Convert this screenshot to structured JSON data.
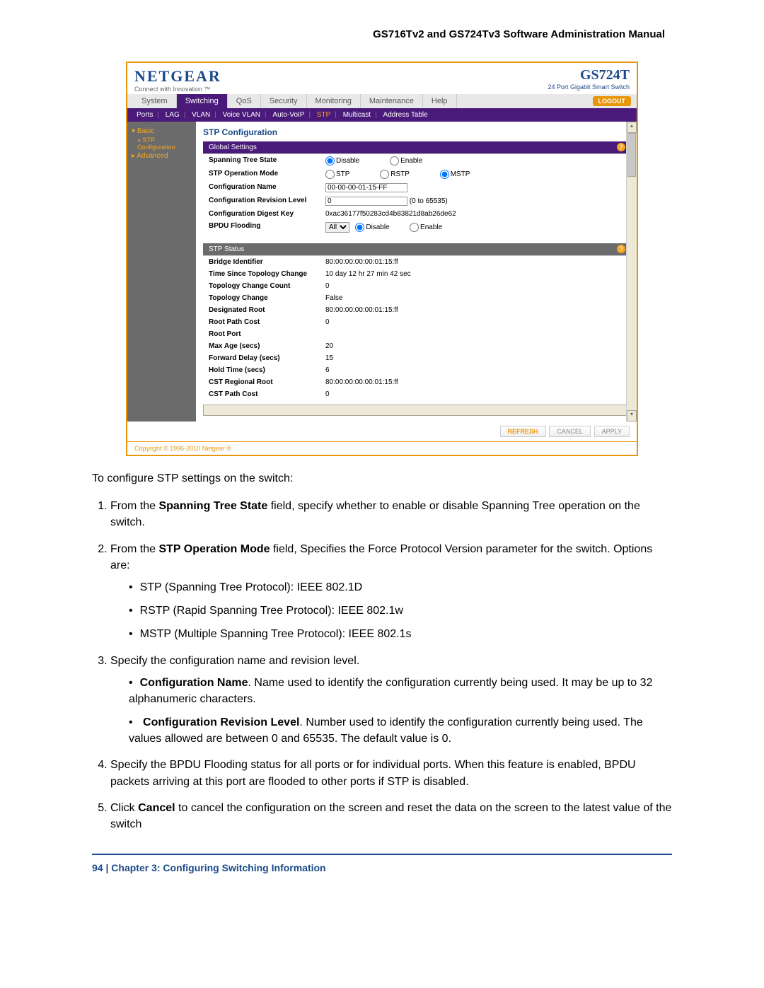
{
  "doc": {
    "header": "GS716Tv2 and GS724Tv3 Software Administration Manual",
    "pagenum": "94",
    "chapter": "Chapter 3:  Configuring Switching Information",
    "footer_sep": "   |   "
  },
  "ui": {
    "logo": "NETGEAR",
    "logosub": "Connect with Innovation ™",
    "model": "GS724T",
    "modelsub": "24 Port Gigabit Smart Switch",
    "logout": "LOGOUT",
    "tabs": [
      "System",
      "Switching",
      "QoS",
      "Security",
      "Monitoring",
      "Maintenance",
      "Help"
    ],
    "active_tab": "Switching",
    "subtabs": [
      "Ports",
      "LAG",
      "VLAN",
      "Voice VLAN",
      "Auto-VoIP",
      "STP",
      "Multicast",
      "Address Table"
    ],
    "active_subtab": "STP",
    "sidebar": {
      "basic": "Basic",
      "stp": "STP",
      "config": "Configuration",
      "advanced": "Advanced"
    },
    "sections": {
      "title": "STP Configuration",
      "global": "Global Settings",
      "status": "STP Status"
    },
    "global_rows": {
      "spanning_tree_state": {
        "label": "Spanning Tree State",
        "opts": [
          "Disable",
          "Enable"
        ],
        "sel": "Disable"
      },
      "stp_mode": {
        "label": "STP Operation Mode",
        "opts": [
          "STP",
          "RSTP",
          "MSTP"
        ],
        "sel": "MSTP"
      },
      "config_name": {
        "label": "Configuration Name",
        "val": "00-00-00-01-15-FF"
      },
      "revision": {
        "label": "Configuration Revision Level",
        "val": "0",
        "hint": "(0 to 65535)"
      },
      "digest": {
        "label": "Configuration Digest Key",
        "val": "0xac36177f50283cd4b83821d8ab26de62"
      },
      "bpdu": {
        "label": "BPDU Flooding",
        "select": "All",
        "opts": [
          "Disable",
          "Enable"
        ],
        "sel": "Disable"
      }
    },
    "status_rows": [
      {
        "label": "Bridge Identifier",
        "val": "80:00:00:00:00:01:15:ff"
      },
      {
        "label": "Time Since Topology Change",
        "val": "10 day 12 hr 27 min 42 sec"
      },
      {
        "label": "Topology Change Count",
        "val": "0"
      },
      {
        "label": "Topology Change",
        "val": "False"
      },
      {
        "label": "Designated Root",
        "val": "80:00:00:00:00:01:15:ff"
      },
      {
        "label": "Root Path Cost",
        "val": "0"
      },
      {
        "label": "Root Port",
        "val": ""
      },
      {
        "label": "Max Age (secs)",
        "val": "20"
      },
      {
        "label": "Forward Delay (secs)",
        "val": "15"
      },
      {
        "label": "Hold Time (secs)",
        "val": "6"
      },
      {
        "label": "CST Regional Root",
        "val": "80:00:00:00:00:01:15:ff"
      },
      {
        "label": "CST Path Cost",
        "val": "0"
      }
    ],
    "buttons": {
      "refresh": "REFRESH",
      "cancel": "CANCEL",
      "apply": "APPLY"
    },
    "copyright": "Copyright © 1996-2010 Netgear ®"
  },
  "instr": {
    "intro": "To configure STP settings on the switch:",
    "step1_a": "From the ",
    "step1_b": "Spanning Tree State",
    "step1_c": " field, specify whether to enable or disable Spanning Tree operation on the switch.",
    "step2_a": "From the ",
    "step2_b": "STP Operation Mode",
    "step2_c": " field, Specifies the Force Protocol Version parameter for the switch. Options are:",
    "step2_bul1": "STP (Spanning Tree Protocol): IEEE 802.1D",
    "step2_bul2": "RSTP (Rapid Spanning Tree Protocol): IEEE 802.1w",
    "step2_bul3": "MSTP (Multiple Spanning Tree Protocol): IEEE 802.1s",
    "step3": "Specify the configuration name and revision level.",
    "step3_b1a": "Configuration Name",
    "step3_b1b": ". Name used to identify the configuration currently being used. It may be up to 32 alphanumeric characters.",
    "step3_b2a": " Configuration Revision Level",
    "step3_b2b": ". Number used to identify the configuration currently being used. The values allowed are between 0 and 65535. The default value is 0.",
    "step4": "Specify the BPDU Flooding status for all ports or for individual ports. When this feature is enabled, BPDU packets arriving at this port are flooded to other ports if STP is disabled.",
    "step5_a": "Click ",
    "step5_b": "Cancel",
    "step5_c": " to cancel the configuration on the screen and reset the data on the screen to the latest value of the switch"
  }
}
